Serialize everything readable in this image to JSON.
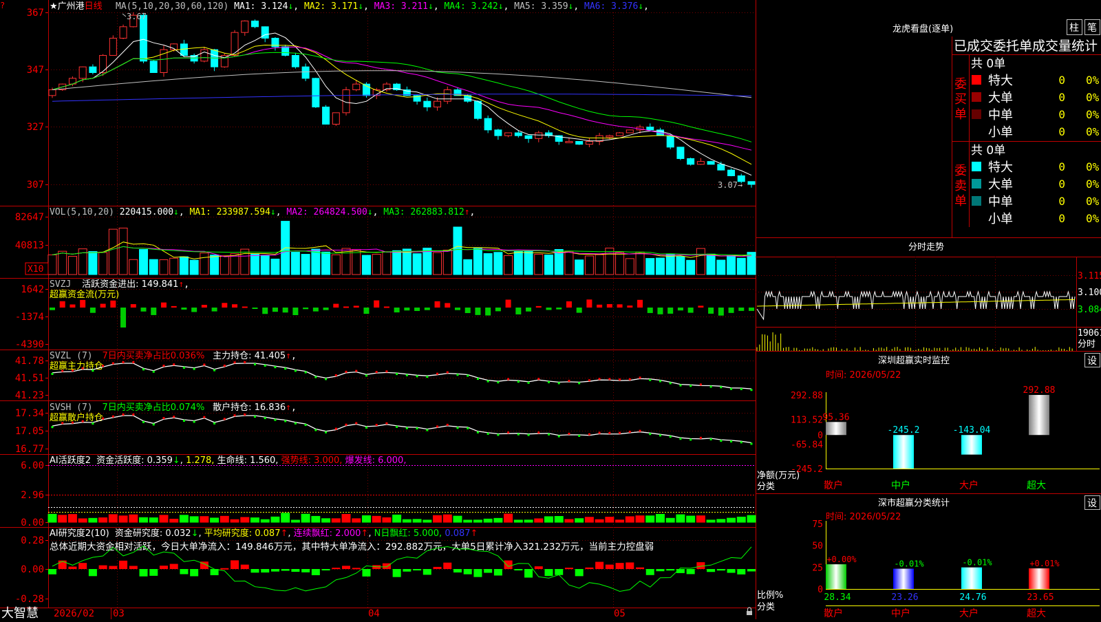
{
  "left": {
    "stock_name": "广州港",
    "period": "日线",
    "star": "★",
    "corner_mark": "?",
    "main": {
      "ma_label": "MA(5,10,20,30,60,120)",
      "ma_items": [
        {
          "label": "MA1:",
          "value": "3.124",
          "arrow": "↓",
          "color": "#ffffff"
        },
        {
          "label": "MA2:",
          "value": "3.171",
          "arrow": "↓",
          "color": "#ffff00"
        },
        {
          "label": "MA3:",
          "value": "3.211",
          "arrow": "↓",
          "color": "#ff00ff"
        },
        {
          "label": "MA4:",
          "value": "3.242",
          "arrow": "↓",
          "color": "#00ff00"
        },
        {
          "label": "MA5:",
          "value": "3.359",
          "arrow": "↓",
          "color": "#c0c0c0"
        },
        {
          "label": "MA6:",
          "value": "3.376",
          "arrow": "↓",
          "color": "#3333ff"
        }
      ],
      "y_ticks": [
        "367",
        "347",
        "327",
        "307"
      ],
      "high_note": "3.67",
      "low_note": "3.07→"
    },
    "vol": {
      "label": "VOL(5,10,20)",
      "value": "220415.000",
      "items": [
        {
          "label": "MA1:",
          "value": "233987.594",
          "arrow": "↓",
          "color": "#ffff00"
        },
        {
          "label": "MA2:",
          "value": "264824.500",
          "arrow": "↓",
          "color": "#ff00ff"
        },
        {
          "label": "MA3:",
          "value": "262883.812",
          "arrow": "↑",
          "color": "#00ff00"
        }
      ],
      "y_ticks": [
        "82647",
        "40813"
      ],
      "unit": "X10"
    },
    "svzj": {
      "label": "SVZJ",
      "text": "活跃资金进出: 149.841",
      "arrow": "↑",
      "sub": "超赢资金流(万元)",
      "y_ticks": [
        "1642",
        "-1374",
        "-4390"
      ]
    },
    "svzl": {
      "label": "SVZL (7)",
      "green_text": "7日内买卖净占比0.036%",
      "text": "主力持仓: 41.405",
      "arrow": "↑",
      "sub": "超赢主力持仓",
      "y_ticks": [
        "41.78",
        "41.51",
        "41.23"
      ]
    },
    "svsh": {
      "label": "SVSH (7)",
      "green_text": "7日内买卖净占比0.074%",
      "text": "散户持仓: 16.836",
      "arrow": "↑",
      "sub": "超赢散户持仓",
      "y_ticks": [
        "17.34",
        "17.05",
        "16.77"
      ]
    },
    "ai1": {
      "label": "AI活跃度2",
      "text1": "资金活跃度: 0.359",
      "text2": "1.278,",
      "text3": "生命线: 1.560,",
      "text4": "强势线: 3.000,",
      "text5": "爆发线: 6.000,",
      "y_ticks": [
        "6.00",
        "2.96",
        "0.00"
      ]
    },
    "ai2": {
      "label": "AI研究度2(10)",
      "text1": "资金研究度: 0.032",
      "text2": "平均研究度: 0.087",
      "text3": "连续飘红: 2.000",
      "text4": "N日飘红: 5.000,",
      "text5": "0.087",
      "summary": "总体近期大资金相对活跃，今日大单净流入：149.846万元，其中特大单净流入：292.882万元，大单5日累计净入321.232万元，当前主力控盘弱",
      "y_ticks": [
        "0.28",
        "0.00",
        "-0.28"
      ]
    },
    "bottom": {
      "brand": "大智慧",
      "dates": [
        "2026/02",
        "03",
        "04",
        "05"
      ]
    }
  },
  "right": {
    "lhb_title": "龙虎看盘(逐单)",
    "btn_col": "柱",
    "btn_pen": "笔",
    "stats_title": "已成交委托单成交量统计",
    "buy": {
      "side": "委买单",
      "total": "共 0单",
      "rows": [
        {
          "name": "特大",
          "count": "0",
          "pct": "0%",
          "color": "#ff0000"
        },
        {
          "name": "大单",
          "count": "0",
          "pct": "0%",
          "color": "#990000"
        },
        {
          "name": "中单",
          "count": "0",
          "pct": "0%",
          "color": "#660000"
        },
        {
          "name": "小单",
          "count": "0",
          "pct": "0%",
          "color": "#000000"
        }
      ]
    },
    "sell": {
      "side": "委卖单",
      "total": "共 0单",
      "rows": [
        {
          "name": "特大",
          "count": "0",
          "pct": "0%",
          "color": "#00ffff"
        },
        {
          "name": "大单",
          "count": "0",
          "pct": "0%",
          "color": "#009999"
        },
        {
          "name": "中单",
          "count": "0",
          "pct": "0%",
          "color": "#007777"
        },
        {
          "name": "小单",
          "count": "0",
          "pct": "0%",
          "color": "#000000"
        }
      ]
    },
    "intraday": {
      "title": "分时走势",
      "y_ticks": [
        "3.115",
        "3.100",
        "3.084"
      ],
      "vol_max": "19061",
      "vol_unit": "分时"
    },
    "monitor": {
      "title": "深圳超赢实时监控",
      "settings": "设",
      "time": "时间: 2026/05/22",
      "y_ticks": [
        "292.88",
        "113.52",
        "0",
        "-65.84",
        "-245.2"
      ],
      "ylabel": "净额(万元)",
      "xlabel": "分类",
      "bars": [
        {
          "cat": "散户",
          "value": 95.36,
          "label": "95.36"
        },
        {
          "cat": "中户",
          "value": -245.2,
          "label": "-245.2"
        },
        {
          "cat": "大户",
          "value": -143.04,
          "label": "-143.04"
        },
        {
          "cat": "超大",
          "value": 292.88,
          "label": "292.88"
        }
      ]
    },
    "stats": {
      "title": "深市超赢分类统计",
      "settings": "设",
      "time": "时间: 2026/05/22",
      "y_ticks": [
        "75",
        "50",
        "25",
        "0"
      ],
      "ylabel": "比例%",
      "xlabel": "分类",
      "bars": [
        {
          "cat": "散户",
          "value": 28.34,
          "change": "+0.00%",
          "label": "28.34"
        },
        {
          "cat": "中户",
          "value": 23.26,
          "change": "-0.01%",
          "label": "23.26"
        },
        {
          "cat": "大户",
          "value": 24.76,
          "change": "-0.01%",
          "label": "24.76"
        },
        {
          "cat": "超大",
          "value": 23.65,
          "change": "+0.01%",
          "label": "23.65"
        }
      ]
    }
  },
  "chart_data": [
    {
      "type": "bar",
      "title": "深圳超赢实时监控",
      "categories": [
        "散户",
        "中户",
        "大户",
        "超大"
      ],
      "values": [
        95.36,
        -245.2,
        -143.04,
        292.88
      ],
      "ylabel": "净额(万元)",
      "xlabel": "分类",
      "ylim": [
        -245.2,
        292.88
      ]
    },
    {
      "type": "bar",
      "title": "深市超赢分类统计",
      "categories": [
        "散户",
        "中户",
        "大户",
        "超大"
      ],
      "values": [
        28.34,
        23.26,
        24.76,
        23.65
      ],
      "ylabel": "比例%",
      "xlabel": "分类",
      "ylim": [
        0,
        75
      ]
    }
  ]
}
